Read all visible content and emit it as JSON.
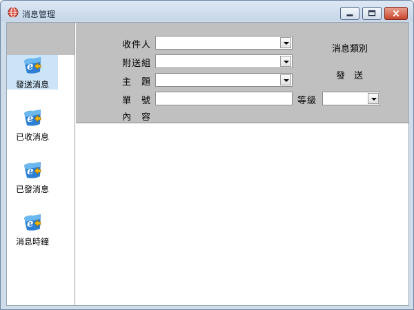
{
  "window": {
    "title": "消息管理",
    "icon": "globe-icon",
    "controls": [
      "minimize-icon",
      "maximize-icon",
      "close-icon"
    ]
  },
  "sidebar": {
    "items": [
      {
        "label": "發送消息",
        "icon": "ie-logo-icon",
        "active": true
      },
      {
        "label": "已收消息",
        "icon": "ie-logo-icon",
        "active": false
      },
      {
        "label": "已發消息",
        "icon": "ie-logo-icon",
        "active": false
      },
      {
        "label": "消息時鐘",
        "icon": "ie-logo-icon",
        "active": false
      }
    ]
  },
  "form": {
    "recipient_label": "收件人",
    "recipient_value": "",
    "attach_group_label": "附送組",
    "attach_group_value": "",
    "subject_label": "主　題",
    "subject_value": "",
    "number_label": "單　號",
    "number_value": "",
    "level_label": "等級",
    "level_value": "",
    "content_label": "內　容",
    "category_link": "消息類別",
    "send_link": "發　送"
  },
  "colors": {
    "panel_gray": "#c0c0c0",
    "active_item": "#cce4f7",
    "window_frame": "#cfdcea"
  }
}
